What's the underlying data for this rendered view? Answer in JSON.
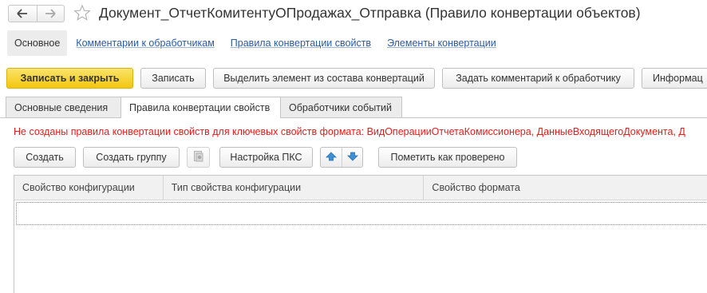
{
  "window": {
    "title": "Документ_ОтчетКомитентуОПродажах_Отправка (Правило конвертации объектов)",
    "back_icon": "arrow-left-icon",
    "forward_icon": "arrow-right-icon",
    "favorite_icon": "star-outline-icon"
  },
  "section_tabs": [
    {
      "label": "Основное"
    },
    {
      "label": "Комментарии к обработчикам"
    },
    {
      "label": "Правила конвертации свойств"
    },
    {
      "label": "Элементы конвертации"
    }
  ],
  "command_bar": {
    "write_close": "Записать и закрыть",
    "write": "Записать",
    "select_element": "Выделить элемент из состава конвертаций",
    "add_comment": "Задать комментарий к обработчику",
    "info": "Информац"
  },
  "content_tabs": [
    {
      "label": "Основные сведения"
    },
    {
      "label": "Правила конвертации свойств"
    },
    {
      "label": "Обработчики событий"
    }
  ],
  "warning": "Не созданы правила конвертации свойств для ключевых свойств формата: ВидОперацииОтчетаКомиссионера, ДанныеВходящегоДокумента, Д",
  "table_toolbar": {
    "create": "Создать",
    "create_group": "Создать группу",
    "pks_settings": "Настройка ПКС",
    "mark_checked": "Пометить как проверено",
    "copy_icon": "copy-icon",
    "up_icon": "move-up-icon",
    "down_icon": "move-down-icon"
  },
  "table": {
    "columns": [
      "Свойство конфигурации",
      "Тип свойства конфигурации",
      "Свойство формата"
    ]
  },
  "colors": {
    "primary_button": "#f3c70f",
    "link": "#2c5aa0",
    "warning": "#e31b1b",
    "arrow_blue": "#3d8fd6"
  }
}
